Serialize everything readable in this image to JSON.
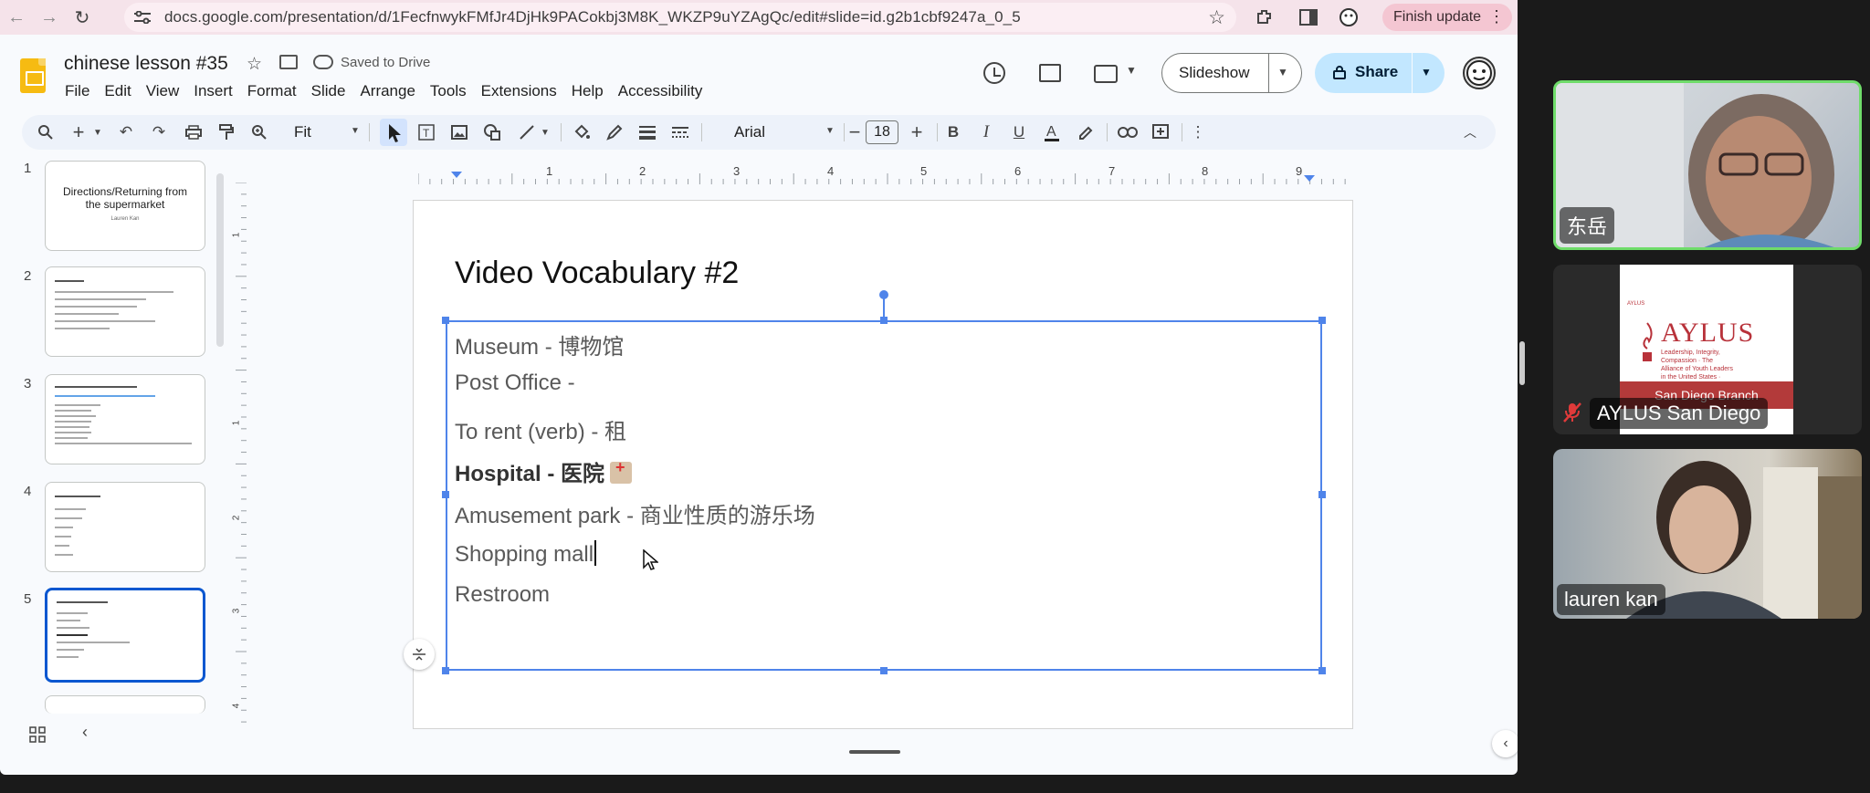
{
  "browser": {
    "url": "docs.google.com/presentation/d/1FecfnwykFMfJr4DjHk9PACokbj3M8K_WKZP9uYZAgQc/edit#slide=id.g2b1cbf9247a_0_5",
    "finish_update": "Finish update"
  },
  "docs": {
    "title": "chinese lesson #35",
    "saved_status": "Saved to Drive",
    "menu": [
      "File",
      "Edit",
      "View",
      "Insert",
      "Format",
      "Slide",
      "Arrange",
      "Tools",
      "Extensions",
      "Help",
      "Accessibility"
    ],
    "slideshow_label": "Slideshow",
    "share_label": "Share"
  },
  "toolbar": {
    "zoom": "Fit",
    "font": "Arial",
    "font_size": "18"
  },
  "filmstrip": {
    "slides": [
      {
        "num": "1",
        "title": "Directions/Returning from the supermarket",
        "subtitle": "Lauren Kan"
      },
      {
        "num": "2"
      },
      {
        "num": "3"
      },
      {
        "num": "4"
      },
      {
        "num": "5",
        "active": true
      }
    ]
  },
  "ruler": {
    "h": [
      "1",
      "2",
      "3",
      "4",
      "5",
      "6",
      "7",
      "8",
      "9"
    ],
    "v": [
      "1",
      "1",
      "2",
      "3",
      "4"
    ]
  },
  "slide": {
    "title": "Video Vocabulary #2",
    "items": [
      {
        "text": "Museum - 博物馆"
      },
      {
        "text": "Post Office -"
      },
      {
        "text": "To rent (verb) - 租"
      },
      {
        "text": "Hospital - 医院",
        "bold": true,
        "emoji": "hospital-icon"
      },
      {
        "text": "Amusement park - 商业性质的游乐场"
      },
      {
        "text": "Shopping mall",
        "caret": true
      },
      {
        "text": "Restroom"
      }
    ]
  },
  "meeting": {
    "participants": [
      {
        "name": "东岳",
        "active": true
      },
      {
        "name": "AYLUS San Diego",
        "muted": true,
        "card_title": "AYLUS",
        "card_small": "AYLUS",
        "card_subtitle": "Leadership, Integrity, Compassion · The Alliance of Youth Leaders in the United States · www.aylus.org",
        "card_band": "San Diego Branch"
      },
      {
        "name": "lauren kan"
      }
    ]
  },
  "colors": {
    "accent": "#0b57d0",
    "selection": "#4f84ea",
    "share_bg": "#c2e7ff",
    "active_speaker": "#6fdc6a",
    "aylus_red": "#b33a3a"
  }
}
